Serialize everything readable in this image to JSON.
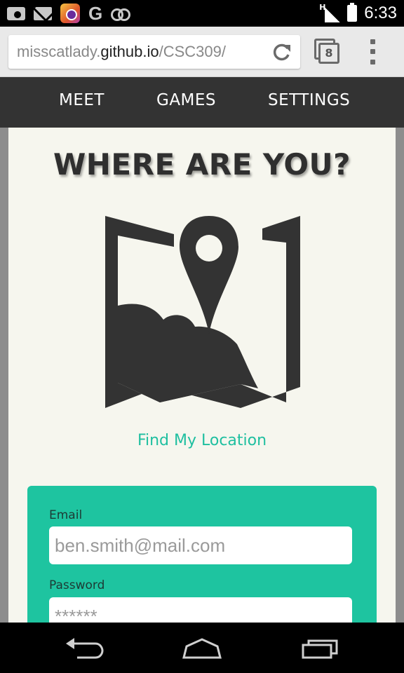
{
  "status_bar": {
    "time": "6:33",
    "network_type": "H",
    "icons": [
      "camera-icon",
      "mail-icon",
      "app-icon",
      "google-icon",
      "voicemail-icon",
      "signal-icon",
      "battery-icon"
    ]
  },
  "browser": {
    "url_prefix": "misscatlady.",
    "url_host": "github.io",
    "url_path": "/CSC309/",
    "tab_count": "8"
  },
  "nav": {
    "items": [
      {
        "label": "MEET"
      },
      {
        "label": "GAMES"
      },
      {
        "label": "SETTINGS"
      }
    ]
  },
  "main": {
    "title": "WHERE ARE YOU?",
    "find_location": "Find My Location",
    "icon": "map-location-icon"
  },
  "login": {
    "email_label": "Email",
    "email_placeholder": "ben.smith@mail.com",
    "password_label": "Password",
    "password_placeholder": "******"
  },
  "colors": {
    "nav_bg": "#333333",
    "accent": "#1ec4a0",
    "link": "#1fbfa0",
    "card_bg": "#f6f6ee",
    "icon_dark": "#333333"
  }
}
